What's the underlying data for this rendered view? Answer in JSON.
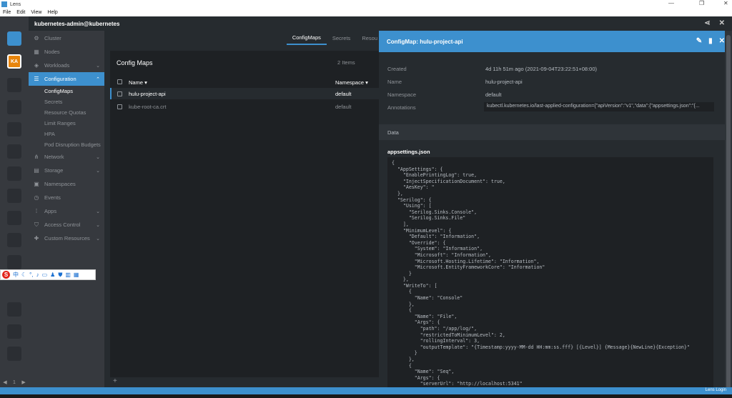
{
  "window": {
    "title": "Lens",
    "minimize": "—",
    "maximize": "❐",
    "close": "✕"
  },
  "menubar": [
    "File",
    "Edit",
    "View",
    "Help"
  ],
  "header": {
    "cluster": "kubernetes-admin@kubernetes"
  },
  "cluster_rail": {
    "avatar_initials": "KA",
    "page": "1"
  },
  "sidebar": {
    "items": [
      {
        "label": "Cluster",
        "icon": "cluster-icon"
      },
      {
        "label": "Nodes",
        "icon": "nodes-icon"
      },
      {
        "label": "Workloads",
        "icon": "workloads-icon"
      },
      {
        "label": "Configuration",
        "icon": "configuration-icon"
      },
      {
        "label": "Network",
        "icon": "network-icon"
      },
      {
        "label": "Storage",
        "icon": "storage-icon"
      },
      {
        "label": "Namespaces",
        "icon": "namespaces-icon"
      },
      {
        "label": "Events",
        "icon": "events-icon"
      },
      {
        "label": "Apps",
        "icon": "apps-icon"
      },
      {
        "label": "Access Control",
        "icon": "access-control-icon"
      },
      {
        "label": "Custom Resources",
        "icon": "custom-resources-icon"
      }
    ],
    "config_sub": [
      "ConfigMaps",
      "Secrets",
      "Resource Quotas",
      "Limit Ranges",
      "HPA",
      "Pod Disruption Budgets"
    ]
  },
  "tabs": [
    "ConfigMaps",
    "Secrets",
    "Resou"
  ],
  "list": {
    "title": "Config Maps",
    "count": "2 Items",
    "col_name": "Name",
    "col_namespace": "Namespace",
    "rows": [
      {
        "name": "hulu-project-api",
        "namespace": "default"
      },
      {
        "name": "kube-root-ca.crt",
        "namespace": "default"
      }
    ]
  },
  "detail": {
    "title": "ConfigMap: hulu-project-api",
    "created_label": "Created",
    "created_value": "4d 11h 51m ago (2021-09-04T23:22:51+08:00)",
    "name_label": "Name",
    "name_value": "hulu-project-api",
    "namespace_label": "Namespace",
    "namespace_value": "default",
    "annotations_label": "Annotations",
    "annotations_value": "kubectl.kubernetes.io/last-applied-configuration={\"apiVersion\":\"v1\",\"data\":{\"appsettings.json\":\"{...",
    "data_label": "Data",
    "json_key": "appsettings.json",
    "json_content": "{\n  \"AppSettings\": {\n    \"EnablePrintingLog\": true,\n    \"InjectSpecificationDocument\": true,\n    \"AesKey\": \"\n  },\n  \"Serilog\": {\n    \"Using\": [\n      \"Serilog.Sinks.Console\",\n      \"Serilog.Sinks.File\"\n    ],\n    \"MinimumLevel\": {\n      \"Default\": \"Information\",\n      \"Override\": {\n        \"System\": \"Information\",\n        \"Microsoft\": \"Information\",\n        \"Microsoft.Hosting.Lifetime\": \"Information\",\n        \"Microsoft.EntityFrameworkCore\": \"Information\"\n      }\n    },\n    \"WriteTo\": [\n      {\n        \"Name\": \"Console\"\n      },\n      {\n        \"Name\": \"File\",\n        \"Args\": {\n          \"path\": \"/app/log/\",\n          \"restrictedToMinimumLevel\": 2,\n          \"rollingInterval\": 3,\n          \"outputTemplate\": \"{Timestamp:yyyy-MM-dd HH:mm:ss.fff} [{Level}] {Message}{NewLine}{Exception}\"\n        }\n      },\n      {\n        \"Name\": \"Seq\",\n        \"Args\": {\n          \"serverUrl\": \"http://localhost:5341\""
  },
  "status": {
    "login": "Lens Login"
  },
  "colors": {
    "accent": "#3d90ce",
    "avatar": "#e8850c"
  }
}
